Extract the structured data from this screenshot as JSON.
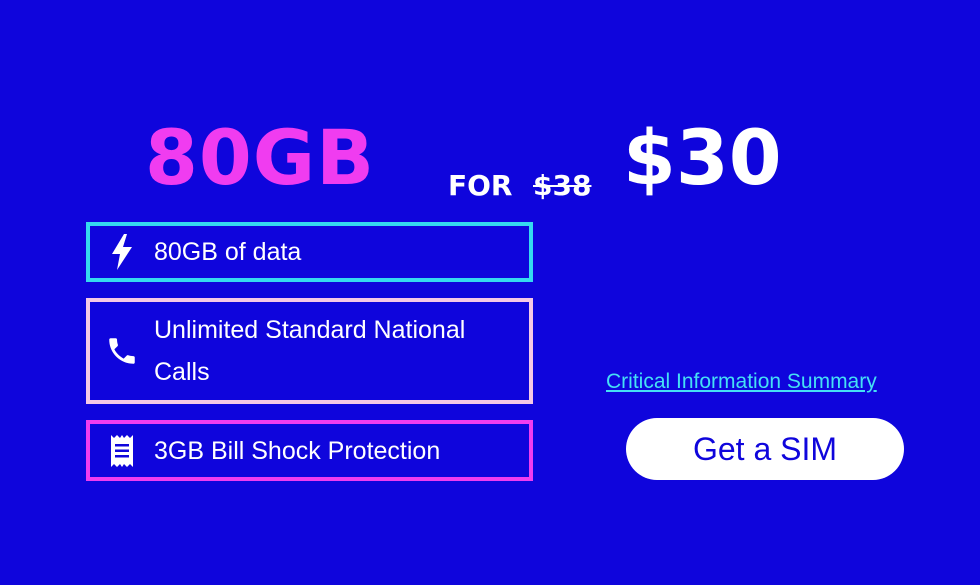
{
  "offer": {
    "data_amount": "80GB",
    "for_text": "FOR",
    "old_price": "$38",
    "new_price": "$30"
  },
  "features": [
    {
      "icon": "lightning-bolt-icon",
      "label": "80GB of data",
      "border_color": "#35d9f0"
    },
    {
      "icon": "phone-icon",
      "label_line1": "Unlimited Standard National",
      "label_line2": "Calls",
      "border_color": "#f5c9e6"
    },
    {
      "icon": "receipt-icon",
      "label": "3GB Bill Shock Protection",
      "border_color": "#f03cf0"
    }
  ],
  "links": {
    "cis": "Critical Information Summary"
  },
  "cta": {
    "label": "Get a SIM"
  },
  "colors": {
    "background": "#0f05dc",
    "accent_pink": "#f03cf0",
    "accent_cyan": "#35d9f0",
    "link": "#45e0f5",
    "text": "#ffffff"
  }
}
